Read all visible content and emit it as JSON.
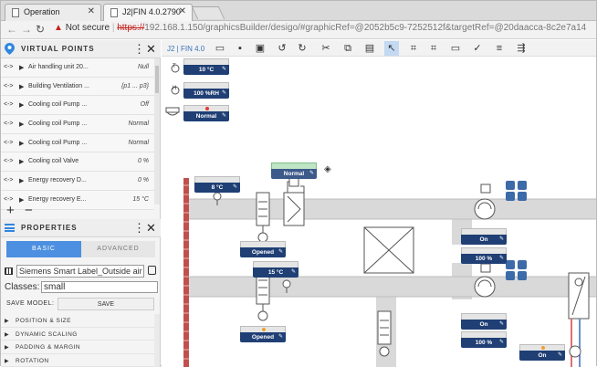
{
  "browser": {
    "tabs": [
      {
        "label": "Operation",
        "active": false
      },
      {
        "label": "J2|FIN 4.0.2790",
        "active": true
      }
    ],
    "address": {
      "security_label": "Not secure",
      "scheme": "https://",
      "url_rest": "192.168.1.150/graphicsBuilder/desigo/#graphicRef=@2052b5c9-7252512f&targetRef=@20daacca-8c2e7a14"
    }
  },
  "virtual_points": {
    "title": "VIRTUAL POINTS",
    "items": [
      {
        "label": "Air handling unit 20...",
        "value": "Null"
      },
      {
        "label": "Building Ventilation ...",
        "value": "{p1 ... p3}"
      },
      {
        "label": "Cooling coil Pump ...",
        "value": "Off"
      },
      {
        "label": "Cooling coil Pump ...",
        "value": "Normal"
      },
      {
        "label": "Cooling coil Pump ...",
        "value": "Normal"
      },
      {
        "label": "Cooling coil Valve",
        "value": "0 %"
      },
      {
        "label": "Energy recovery D...",
        "value": "0 %"
      },
      {
        "label": "Energy recovery E...",
        "value": "15 °C"
      }
    ],
    "row_arrow": "<->",
    "footer_add": "+",
    "footer_remove": "−",
    "splitter": "..."
  },
  "properties": {
    "title": "PROPERTIES",
    "tab_basic": "BASIC",
    "tab_advanced": "ADVANCED",
    "label_value": "Siemens Smart Label_Outside air filter",
    "classes_label": "Classes:",
    "classes_value": "small",
    "save_model_label": "SAVE MODEL:",
    "save_button": "SAVE",
    "sections": [
      "POSITION & SIZE",
      "DYNAMIC SCALING",
      "PADDING & MARGIN",
      "ROTATION"
    ]
  },
  "toolbar": {
    "brand": "J2 | FIN 4.0"
  },
  "canvas": {
    "legend": [
      {
        "letter": "T",
        "value": "10 °C"
      },
      {
        "letter": "H",
        "value": "100 %RH"
      },
      {
        "letter": "",
        "value": "Normal"
      }
    ],
    "labels": {
      "normal_green": "Normal",
      "temp_8": "8 °C",
      "opened_1": "Opened",
      "temp_15": "15 °C",
      "opened_2": "Opened",
      "on_1": "On",
      "pct_1": "100 %",
      "on_2": "On",
      "pct_2": "100 %",
      "on_3": "On"
    },
    "colors": {
      "chip_blue": "#1f3f75",
      "duct_gray": "#d8d8d8",
      "wall_red": "#c0504d",
      "alarm_red": "#e53935",
      "status_orange": "#f0a030"
    }
  }
}
